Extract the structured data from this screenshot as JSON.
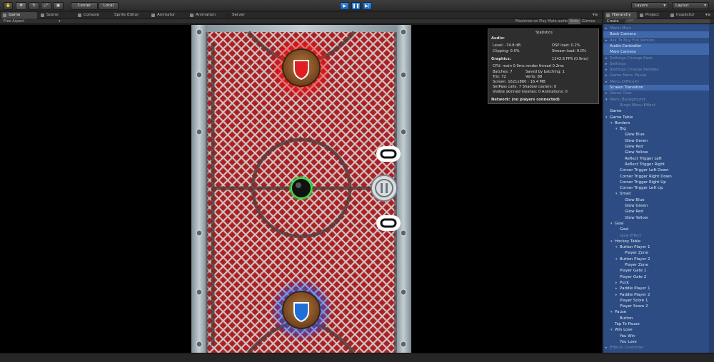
{
  "toolbar": {
    "center_label": "Center",
    "local_label": "Local",
    "layers_label": "Layers",
    "layout_label": "Layout"
  },
  "tabs": [
    {
      "label": "Game",
      "icon": "game-icon"
    },
    {
      "label": "Scene",
      "icon": "scene-icon"
    },
    {
      "label": "Console",
      "icon": "console-icon"
    },
    {
      "label": "Sprite Editor",
      "icon": "sprite-editor-icon"
    },
    {
      "label": "Animator",
      "icon": "animator-icon"
    },
    {
      "label": "Animation",
      "icon": "animation-icon"
    },
    {
      "label": "Server",
      "icon": "server-icon"
    }
  ],
  "game_bar": {
    "aspect": "Free Aspect",
    "maximize": "Maximize on Play",
    "mute": "Mute audio",
    "stats": "Stats",
    "gizmos": "Gizmos"
  },
  "stats": {
    "title": "Statistics",
    "audio_header": "Audio:",
    "level": "Level: -74.8 dB",
    "dsp": "DSP load: 0.2%",
    "clipping": "Clipping: 0.0%",
    "stream": "Stream load: 0.0%",
    "graphics_header": "Graphics:",
    "fps": "1142.6 FPS (0.9ms)",
    "cpu": "CPU: main 0.9ms  render thread 0.2ms",
    "batches": "Batches: 7",
    "saved": "Saved by batching: 1",
    "tris": "Tris: 72",
    "verts": "Verts: 88",
    "screen": "Screen: 1621x880 - 16.4 MB",
    "setpass": "SetPass calls: 7    Shadow casters: 0",
    "skinned": "Visible skinned meshes: 0  Animations: 0",
    "network": "Network: (no players connected)"
  },
  "hierarchy": {
    "tab_label": "Hierarchy",
    "project_label": "Project",
    "inspector_label": "Inspector",
    "create_label": "Create",
    "search_placeholder": "▸All",
    "items": [
      {
        "label": "Menu Main",
        "depth": 0,
        "arrow": "▸",
        "dim": true,
        "sel": false
      },
      {
        "label": "Back Camera",
        "depth": 0,
        "arrow": "",
        "dim": false,
        "sel": true
      },
      {
        "label": "Ask To Buy Full Version",
        "depth": 0,
        "arrow": "▸",
        "dim": true,
        "sel": false
      },
      {
        "label": "Audio Controller",
        "depth": 0,
        "arrow": "",
        "dim": false,
        "sel": true
      },
      {
        "label": "Main Camera",
        "depth": 0,
        "arrow": "",
        "dim": false,
        "sel": true
      },
      {
        "label": "Settings Change Pack",
        "depth": 0,
        "arrow": "▸",
        "dim": true,
        "sel": false
      },
      {
        "label": "Settings",
        "depth": 0,
        "arrow": "▸",
        "dim": true,
        "sel": false
      },
      {
        "label": "Settings Change Paddles",
        "depth": 0,
        "arrow": "▸",
        "dim": true,
        "sel": false
      },
      {
        "label": "Game Menu Pause",
        "depth": 0,
        "arrow": "▸",
        "dim": true,
        "sel": false
      },
      {
        "label": "Menu Difficulty",
        "depth": 0,
        "arrow": "▸",
        "dim": true,
        "sel": false
      },
      {
        "label": "Screen Transition",
        "depth": 0,
        "arrow": "",
        "dim": false,
        "sel": true
      },
      {
        "label": "Game Over",
        "depth": 0,
        "arrow": "▸",
        "dim": true,
        "sel": false
      },
      {
        "label": "Menu Background",
        "depth": 0,
        "arrow": "▾",
        "dim": true,
        "sel": false
      },
      {
        "label": "Rings Menu Effect",
        "depth": 2,
        "arrow": "",
        "dim": true,
        "sel": false
      },
      {
        "label": "Game",
        "depth": 0,
        "arrow": "",
        "dim": false,
        "sel": false
      },
      {
        "label": "Game Table",
        "depth": 0,
        "arrow": "▾",
        "dim": false,
        "sel": false
      },
      {
        "label": "Borders",
        "depth": 1,
        "arrow": "▾",
        "dim": false,
        "sel": false
      },
      {
        "label": "Big",
        "depth": 2,
        "arrow": "▾",
        "dim": false,
        "sel": false
      },
      {
        "label": "Glow Blue",
        "depth": 3,
        "arrow": "",
        "dim": false,
        "sel": false
      },
      {
        "label": "Glow Green",
        "depth": 3,
        "arrow": "",
        "dim": false,
        "sel": false
      },
      {
        "label": "Glow Red",
        "depth": 3,
        "arrow": "",
        "dim": false,
        "sel": false
      },
      {
        "label": "Glow Yellow",
        "depth": 3,
        "arrow": "",
        "dim": false,
        "sel": false
      },
      {
        "label": "Reflect Trigger Left",
        "depth": 3,
        "arrow": "",
        "dim": false,
        "sel": false
      },
      {
        "label": "Reflect Trigger Right",
        "depth": 3,
        "arrow": "",
        "dim": false,
        "sel": false
      },
      {
        "label": "Corner Trigger Left Down",
        "depth": 2,
        "arrow": "",
        "dim": false,
        "sel": false
      },
      {
        "label": "Corner Trigger Right Down",
        "depth": 2,
        "arrow": "",
        "dim": false,
        "sel": false
      },
      {
        "label": "Corner Trigger Right Up",
        "depth": 2,
        "arrow": "",
        "dim": false,
        "sel": false
      },
      {
        "label": "Corner Trigger Left Up",
        "depth": 2,
        "arrow": "",
        "dim": false,
        "sel": false
      },
      {
        "label": "Small",
        "depth": 2,
        "arrow": "▾",
        "dim": false,
        "sel": false
      },
      {
        "label": "Glow Blue",
        "depth": 3,
        "arrow": "",
        "dim": false,
        "sel": false
      },
      {
        "label": "Glow Green",
        "depth": 3,
        "arrow": "",
        "dim": false,
        "sel": false
      },
      {
        "label": "Glow Red",
        "depth": 3,
        "arrow": "",
        "dim": false,
        "sel": false
      },
      {
        "label": "Glow Yellow",
        "depth": 3,
        "arrow": "",
        "dim": false,
        "sel": false
      },
      {
        "label": "Goal",
        "depth": 1,
        "arrow": "▾",
        "dim": false,
        "sel": false
      },
      {
        "label": "Goal",
        "depth": 2,
        "arrow": "",
        "dim": false,
        "sel": false
      },
      {
        "label": "Goal Effect",
        "depth": 2,
        "arrow": "",
        "dim": true,
        "sel": false
      },
      {
        "label": "Hockey Table",
        "depth": 1,
        "arrow": "▾",
        "dim": false,
        "sel": false
      },
      {
        "label": "Button Player 1",
        "depth": 2,
        "arrow": "▾",
        "dim": false,
        "sel": false
      },
      {
        "label": "Player Zone",
        "depth": 3,
        "arrow": "",
        "dim": false,
        "sel": false
      },
      {
        "label": "Button Player 2",
        "depth": 2,
        "arrow": "▾",
        "dim": false,
        "sel": false
      },
      {
        "label": "Player Zone",
        "depth": 3,
        "arrow": "",
        "dim": false,
        "sel": false
      },
      {
        "label": "Player Gate 1",
        "depth": 2,
        "arrow": "",
        "dim": false,
        "sel": false
      },
      {
        "label": "Player Gate 2",
        "depth": 2,
        "arrow": "",
        "dim": false,
        "sel": false
      },
      {
        "label": "Puck",
        "depth": 2,
        "arrow": "▸",
        "dim": false,
        "sel": false
      },
      {
        "label": "Paddle Player 1",
        "depth": 2,
        "arrow": "▸",
        "dim": false,
        "sel": false
      },
      {
        "label": "Paddle Player 2",
        "depth": 2,
        "arrow": "▸",
        "dim": false,
        "sel": false
      },
      {
        "label": "Player Score 1",
        "depth": 2,
        "arrow": "",
        "dim": false,
        "sel": false
      },
      {
        "label": "Player Score 2",
        "depth": 2,
        "arrow": "",
        "dim": false,
        "sel": false
      },
      {
        "label": "Pause",
        "depth": 1,
        "arrow": "▾",
        "dim": false,
        "sel": false
      },
      {
        "label": "Button",
        "depth": 2,
        "arrow": "",
        "dim": false,
        "sel": false
      },
      {
        "label": "Tap To Pause",
        "depth": 1,
        "arrow": "",
        "dim": false,
        "sel": false
      },
      {
        "label": "Win Lose",
        "depth": 1,
        "arrow": "▾",
        "dim": false,
        "sel": false
      },
      {
        "label": "You Win",
        "depth": 2,
        "arrow": "",
        "dim": false,
        "sel": false
      },
      {
        "label": "You Lose",
        "depth": 2,
        "arrow": "",
        "dim": false,
        "sel": false
      },
      {
        "label": "Effects Controller",
        "depth": 0,
        "arrow": "▸",
        "dim": true,
        "sel": false
      }
    ]
  },
  "colors": {
    "accent": "#3c8ad8",
    "hierarchy_bg": "#2c4c83",
    "selected_row": "#3f68aa",
    "red_paddle": "#e02020",
    "blue_paddle": "#1e6fd8",
    "puck_glow": "#2ecc40"
  }
}
